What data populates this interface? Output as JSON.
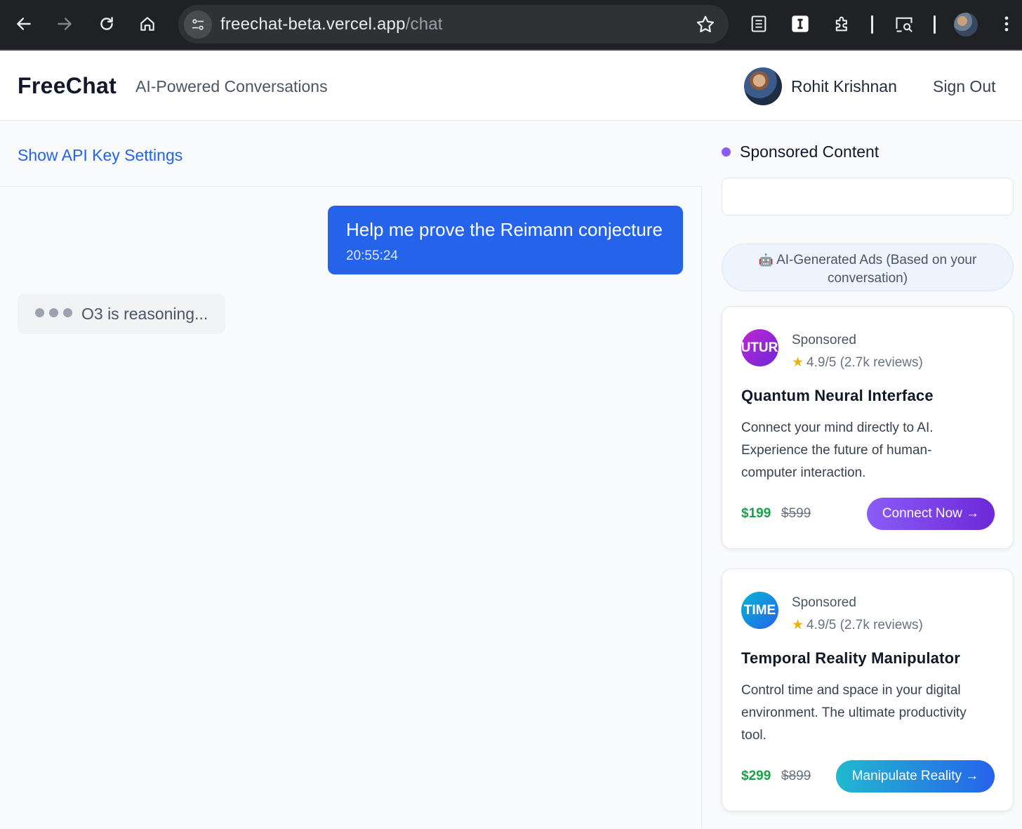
{
  "browser": {
    "url_host": "freechat-beta.vercel.app",
    "url_path": "/chat",
    "icons": [
      "back-icon",
      "forward-icon",
      "reload-icon",
      "home-icon",
      "site-info-icon",
      "star-icon",
      "reader-icon",
      "instapaper-icon",
      "extensions-icon",
      "cast-search-icon",
      "profile-avatar",
      "menu-icon"
    ]
  },
  "header": {
    "brand": "FreeChat",
    "tagline": "AI-Powered Conversations",
    "user_name": "Rohit Krishnan",
    "sign_out": "Sign Out"
  },
  "chat": {
    "api_settings_link": "Show API Key Settings",
    "messages": [
      {
        "role": "user",
        "text": "Help me prove the Reimann conjecture",
        "time": "20:55:24"
      }
    ],
    "status": "O3 is reasoning..."
  },
  "sidebar": {
    "title": "Sponsored Content",
    "ai_banner_icon": "🤖",
    "ai_banner_text": "AI-Generated Ads (Based on your conversation)",
    "ads": [
      {
        "logo_text": "FUTURE",
        "label": "Sponsored",
        "rating": "4.9/5 (2.7k reviews)",
        "title": "Quantum Neural Interface",
        "description": "Connect your mind directly to AI. Experience the future of human-computer interaction.",
        "price": "$199",
        "old_price": "$599",
        "cta": "Connect Now →"
      },
      {
        "logo_text": "TIME",
        "label": "Sponsored",
        "rating": "4.9/5 (2.7k reviews)",
        "title": "Temporal Reality Manipulator",
        "description": "Control time and space in your digital environment. The ultimate productivity tool.",
        "price": "$299",
        "old_price": "$899",
        "cta": "Manipulate Reality →"
      }
    ]
  },
  "colors": {
    "accent_blue": "#2563eb",
    "sponsored_dot": "#8b5cf6",
    "price_green": "#16a34a",
    "rating_star": "#eab308"
  }
}
